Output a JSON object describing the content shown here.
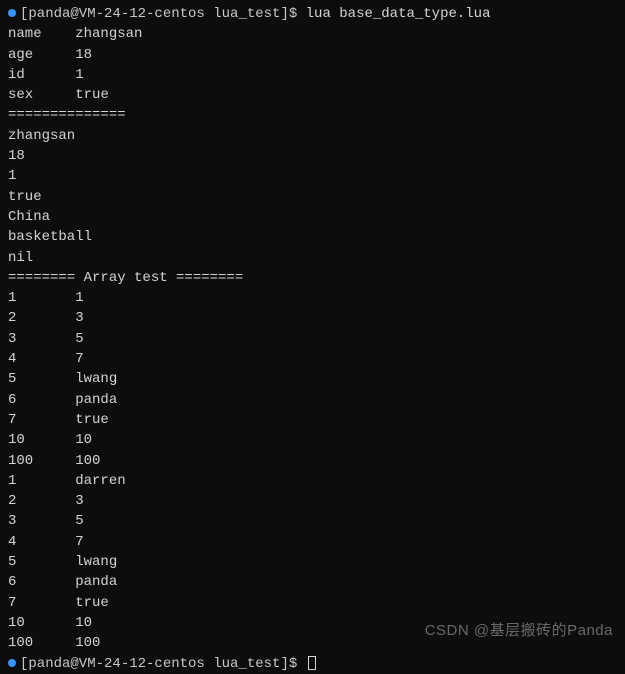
{
  "prompt1": {
    "full": "[panda@VM-24-12-centos lua_test]$ ",
    "command": "lua base_data_type.lua"
  },
  "output": {
    "kv": [
      {
        "k": "name",
        "v": "zhangsan"
      },
      {
        "k": "age",
        "v": "18"
      },
      {
        "k": "id",
        "v": "1"
      },
      {
        "k": "sex",
        "v": "true"
      }
    ],
    "sep1": "==============",
    "vals": [
      "zhangsan",
      "18",
      "1",
      "true",
      "China",
      "basketball",
      "nil"
    ],
    "sep2": "======== Array test ========",
    "array": [
      {
        "k": "1",
        "v": "1"
      },
      {
        "k": "2",
        "v": "3"
      },
      {
        "k": "3",
        "v": "5"
      },
      {
        "k": "4",
        "v": "7"
      },
      {
        "k": "5",
        "v": "lwang"
      },
      {
        "k": "6",
        "v": "panda"
      },
      {
        "k": "7",
        "v": "true"
      },
      {
        "k": "10",
        "v": "10"
      },
      {
        "k": "100",
        "v": "100"
      },
      {
        "k": "1",
        "v": "darren"
      },
      {
        "k": "2",
        "v": "3"
      },
      {
        "k": "3",
        "v": "5"
      },
      {
        "k": "4",
        "v": "7"
      },
      {
        "k": "5",
        "v": "lwang"
      },
      {
        "k": "6",
        "v": "panda"
      },
      {
        "k": "7",
        "v": "true"
      },
      {
        "k": "10",
        "v": "10"
      },
      {
        "k": "100",
        "v": "100"
      }
    ]
  },
  "prompt2": {
    "full": "[panda@VM-24-12-centos lua_test]$ "
  },
  "watermark": "CSDN @基层搬砖的Panda"
}
